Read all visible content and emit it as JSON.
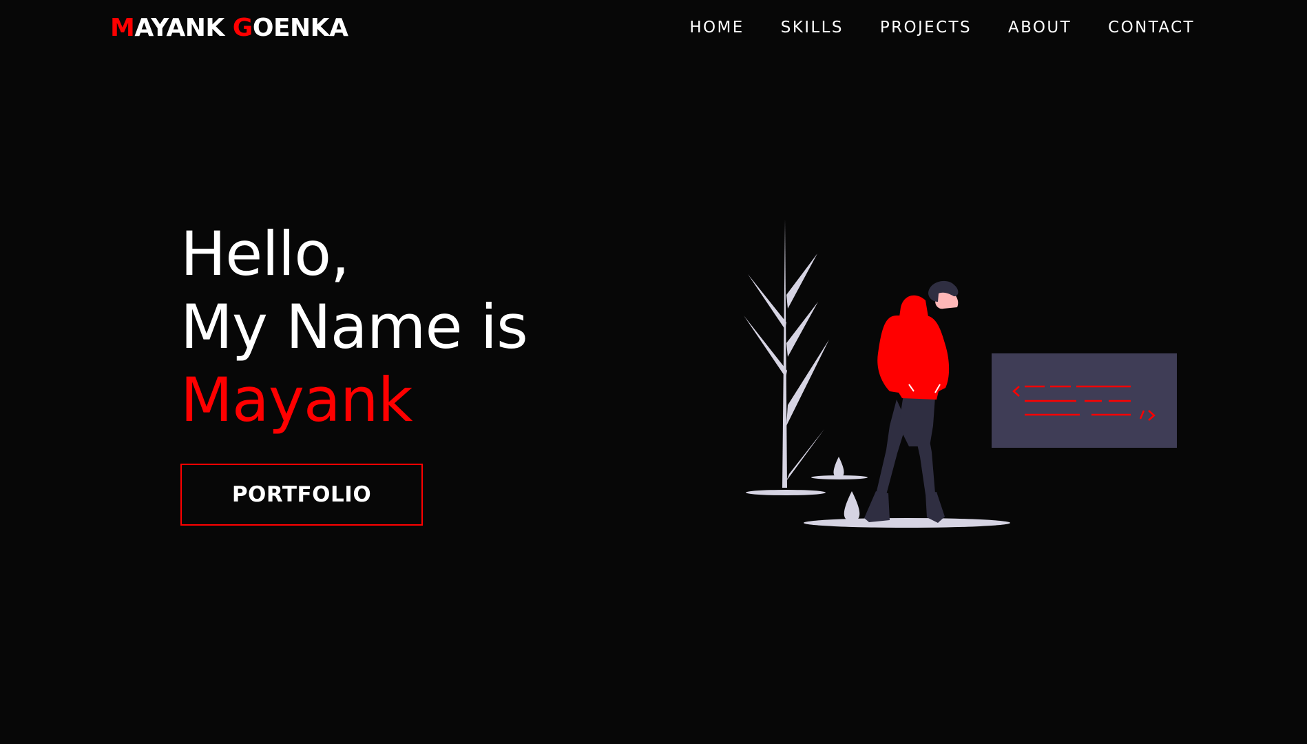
{
  "header": {
    "logo_first_initial": "M",
    "logo_first_rest": "AYANK ",
    "logo_last_initial": "G",
    "logo_last_rest": "OENKA"
  },
  "nav": {
    "items": [
      {
        "label": "HOME"
      },
      {
        "label": "SKILLS"
      },
      {
        "label": "PROJECTS"
      },
      {
        "label": "ABOUT"
      },
      {
        "label": "CONTACT"
      }
    ]
  },
  "hero": {
    "line1": "Hello,",
    "line2": "My Name is",
    "name": "Mayank",
    "button_label": "PORTFOLIO"
  },
  "illustration": {
    "code_open": "<",
    "code_close": "/>",
    "icon": "developer-illustration"
  },
  "colors": {
    "background": "#070707",
    "accent": "#ff0000",
    "text": "#ffffff",
    "panel": "#3f3d56",
    "plant": "#d6d4e3"
  }
}
